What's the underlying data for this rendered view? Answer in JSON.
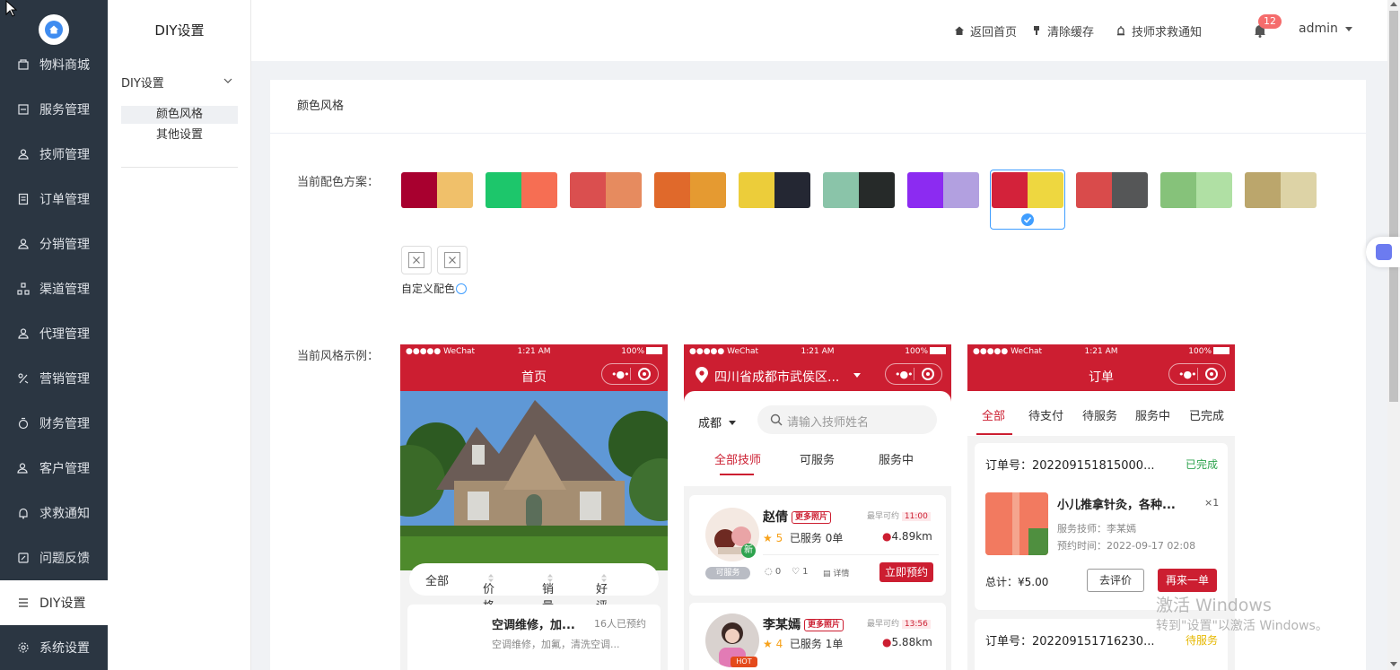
{
  "sidebar": {
    "items": [
      {
        "label": "物料商城",
        "icon": "shop-icon"
      },
      {
        "label": "服务管理",
        "icon": "service-icon"
      },
      {
        "label": "技师管理",
        "icon": "technician-icon"
      },
      {
        "label": "订单管理",
        "icon": "order-icon"
      },
      {
        "label": "分销管理",
        "icon": "distribution-icon"
      },
      {
        "label": "渠道管理",
        "icon": "channel-icon"
      },
      {
        "label": "代理管理",
        "icon": "agent-icon"
      },
      {
        "label": "营销管理",
        "icon": "marketing-icon"
      },
      {
        "label": "财务管理",
        "icon": "finance-icon"
      },
      {
        "label": "客户管理",
        "icon": "customer-icon"
      },
      {
        "label": "求救通知",
        "icon": "alarm-bell-icon"
      },
      {
        "label": "问题反馈",
        "icon": "feedback-icon"
      },
      {
        "label": "DIY设置",
        "icon": "diy-icon"
      },
      {
        "label": "系统设置",
        "icon": "settings-icon"
      }
    ],
    "active_index": 12
  },
  "subnav": {
    "title": "DIY设置",
    "group": "DIY设置",
    "items": [
      "颜色风格",
      "其他设置"
    ]
  },
  "header": {
    "links": [
      "返回首页",
      "清除缓存",
      "技师求救通知"
    ],
    "badge_count": "12",
    "user": "admin"
  },
  "content": {
    "card_title": "颜色风格",
    "scheme_label": "当前配色方案：",
    "custom_label": "自定义配色",
    "preview_label": "当前风格示例：",
    "swatches": [
      [
        "#a8002f",
        "#f0c06a"
      ],
      [
        "#1dc66b",
        "#f66e53"
      ],
      [
        "#da4f4f",
        "#e68b5f"
      ],
      [
        "#e0692b",
        "#e59a31"
      ],
      [
        "#eccd3a",
        "#242733"
      ],
      [
        "#8ac4a9",
        "#262a29"
      ],
      [
        "#8c2bf1",
        "#b2a0e0"
      ],
      [
        "#d3223a",
        "#eed740"
      ],
      [
        "#d94b4b",
        "#555657"
      ],
      [
        "#86c27a",
        "#b0e0a4"
      ],
      [
        "#bba66c",
        "#ddd3a6"
      ]
    ],
    "selected_swatch": 7,
    "theme_color": "#cc1e31"
  },
  "phones": {
    "status": {
      "carrier": "●●●●● WeChat",
      "time": "1:21 AM",
      "battery": "100%"
    },
    "home": {
      "title": "首页",
      "filters": [
        "全部",
        "价格",
        "销量",
        "好评度"
      ],
      "service_name": "空调维修，加...",
      "service_booked": "16人已预约",
      "service_desc": "空调维修，加氟，清洗空调..."
    },
    "tech": {
      "location": "四川省成都市武侯区...",
      "city": "成都",
      "search_placeholder": "请输入技师姓名",
      "tabs": [
        "全部技师",
        "可服务",
        "服务中"
      ],
      "list": [
        {
          "name": "赵倩",
          "tag": "更多照片",
          "earliest": "最早可约",
          "time": "11:00",
          "rating": "5",
          "served": "已服务 0单",
          "distance": "4.89km",
          "badge": "可服务",
          "new_tag": "新",
          "comments": "0",
          "likes": "1",
          "detail": "详情",
          "button": "立即预约"
        },
        {
          "name": "李某嫣",
          "tag": "更多照片",
          "earliest": "最早可约",
          "time": "13:56",
          "rating": "4",
          "served": "已服务 1单",
          "distance": "5.88km",
          "hot_tag": "HOT"
        }
      ]
    },
    "orders": {
      "title": "订单",
      "tabs": [
        "全部",
        "待支付",
        "待服务",
        "服务中",
        "已完成"
      ],
      "list": [
        {
          "no": "订单号：202209151815000...",
          "status": "已完成",
          "name": "小儿推拿针灸，各种...",
          "qty": "×1",
          "tech": "服务技师：李某嫣",
          "time": "预约时间：2022-09-17 02:08",
          "total": "总计：¥5.00",
          "btn1": "去评价",
          "btn2": "再来一单"
        },
        {
          "no": "订单号：202209151716230...",
          "status": "待服务"
        }
      ]
    }
  },
  "watermark": {
    "line1": "激活 Windows",
    "line2": "转到\"设置\"以激活 Windows。"
  }
}
